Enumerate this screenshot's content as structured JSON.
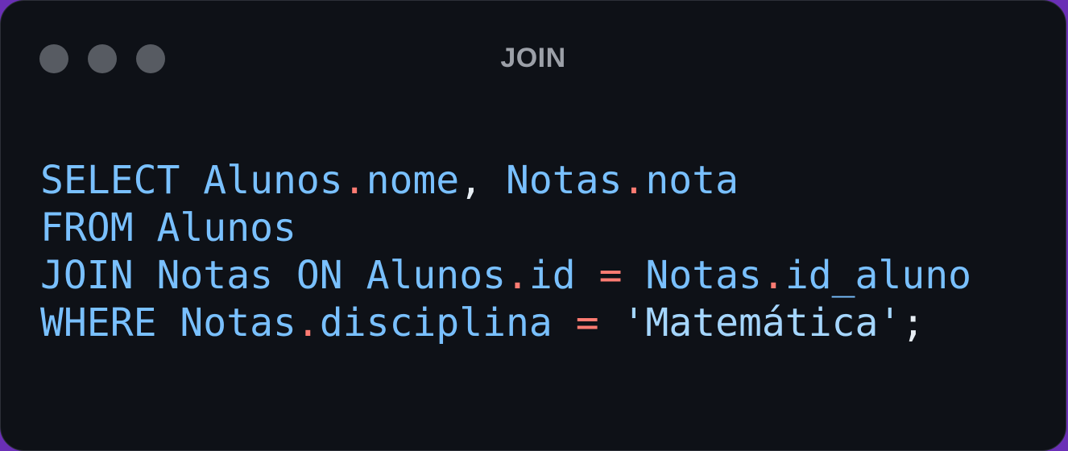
{
  "window": {
    "title": "JOIN",
    "controls": [
      "close",
      "minimize",
      "maximize"
    ]
  },
  "colors": {
    "background": "#6a2fb6",
    "window": "#0e1117",
    "dot": "#575b62",
    "title": "#9ca0a8",
    "keyword": "#79c0ff",
    "identifier": "#79c0ff",
    "operator": "#ff7b72",
    "string": "#a5d6ff",
    "punct": "#e6edf3"
  },
  "code": {
    "language": "SQL",
    "lines": [
      [
        {
          "text": "SELECT",
          "kind": "keyword"
        },
        {
          "text": " ",
          "kind": "plain"
        },
        {
          "text": "Alunos",
          "kind": "identifier"
        },
        {
          "text": ".",
          "kind": "operator"
        },
        {
          "text": "nome",
          "kind": "identifier"
        },
        {
          "text": ", ",
          "kind": "punct"
        },
        {
          "text": "Notas",
          "kind": "identifier"
        },
        {
          "text": ".",
          "kind": "operator"
        },
        {
          "text": "nota",
          "kind": "identifier"
        }
      ],
      [
        {
          "text": "FROM",
          "kind": "keyword"
        },
        {
          "text": " ",
          "kind": "plain"
        },
        {
          "text": "Alunos",
          "kind": "identifier"
        }
      ],
      [
        {
          "text": "JOIN",
          "kind": "keyword"
        },
        {
          "text": " ",
          "kind": "plain"
        },
        {
          "text": "Notas",
          "kind": "identifier"
        },
        {
          "text": " ",
          "kind": "plain"
        },
        {
          "text": "ON",
          "kind": "keyword"
        },
        {
          "text": " ",
          "kind": "plain"
        },
        {
          "text": "Alunos",
          "kind": "identifier"
        },
        {
          "text": ".",
          "kind": "operator"
        },
        {
          "text": "id",
          "kind": "identifier"
        },
        {
          "text": " ",
          "kind": "plain"
        },
        {
          "text": "=",
          "kind": "operator"
        },
        {
          "text": " ",
          "kind": "plain"
        },
        {
          "text": "Notas",
          "kind": "identifier"
        },
        {
          "text": ".",
          "kind": "operator"
        },
        {
          "text": "id_aluno",
          "kind": "identifier"
        }
      ],
      [
        {
          "text": "WHERE",
          "kind": "keyword"
        },
        {
          "text": " ",
          "kind": "plain"
        },
        {
          "text": "Notas",
          "kind": "identifier"
        },
        {
          "text": ".",
          "kind": "operator"
        },
        {
          "text": "disciplina",
          "kind": "identifier"
        },
        {
          "text": " ",
          "kind": "plain"
        },
        {
          "text": "=",
          "kind": "operator"
        },
        {
          "text": " ",
          "kind": "plain"
        },
        {
          "text": "'Matemática'",
          "kind": "string"
        },
        {
          "text": ";",
          "kind": "punct"
        }
      ]
    ]
  }
}
